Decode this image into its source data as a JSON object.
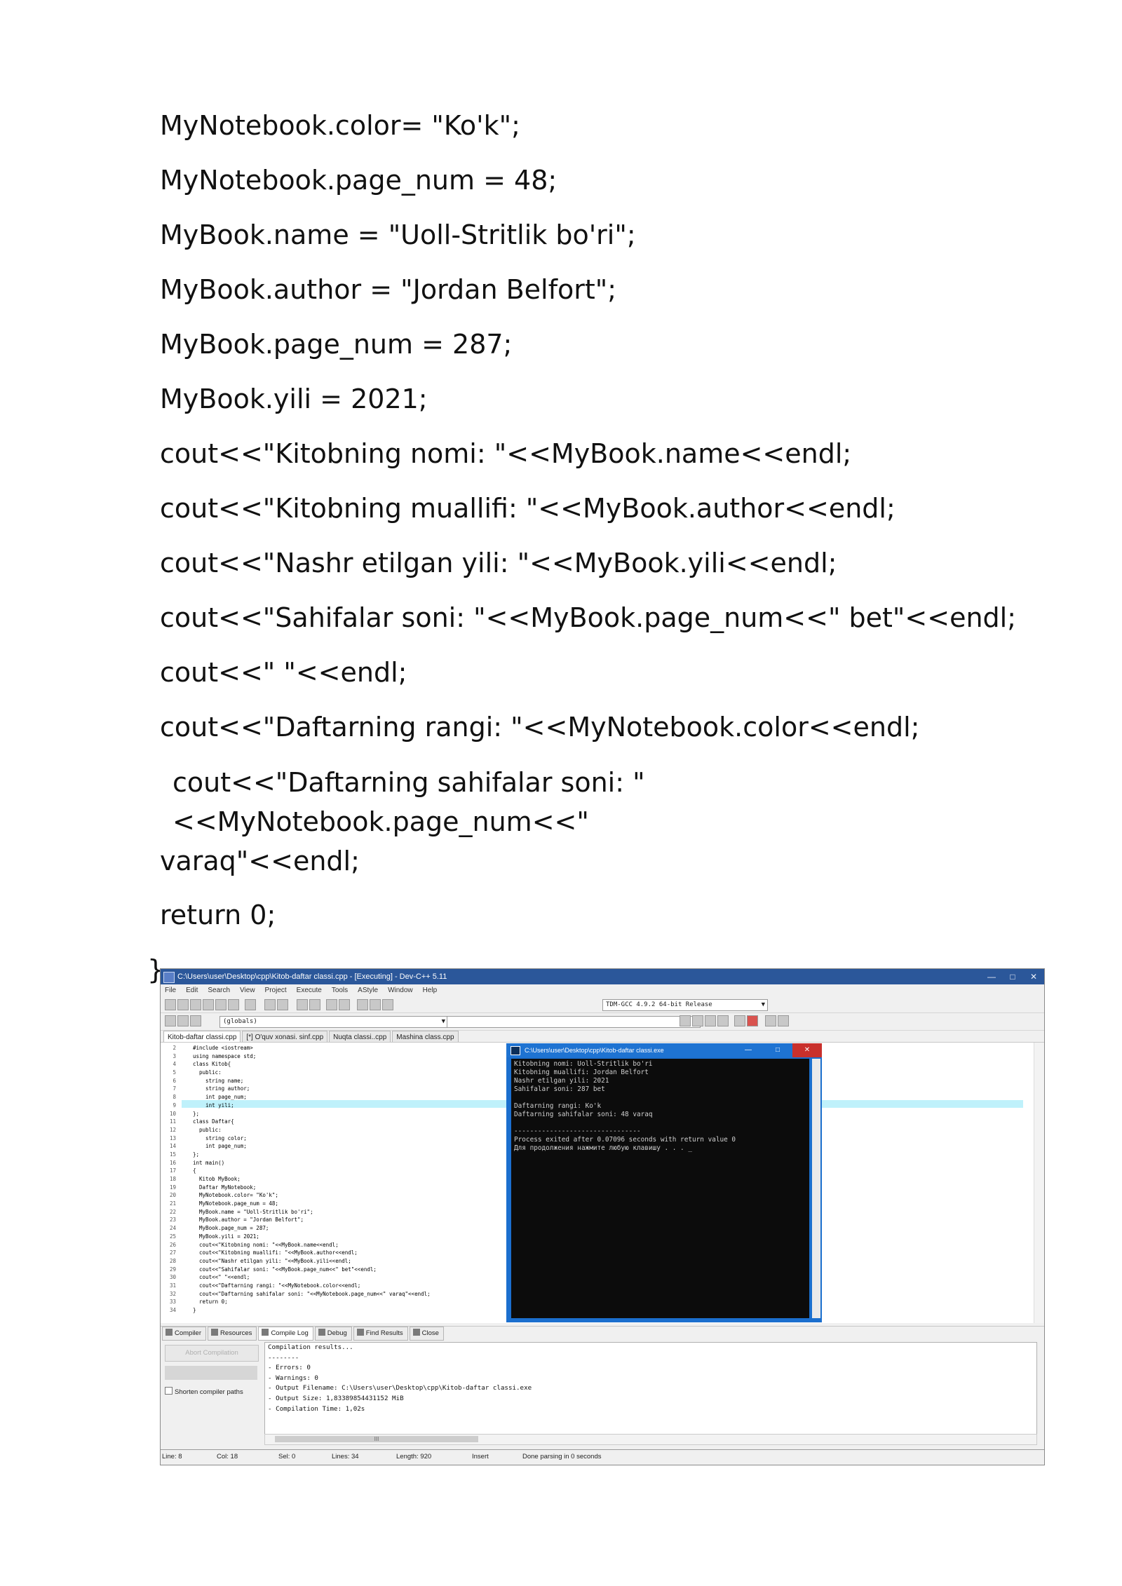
{
  "document": {
    "lines": [
      "MyNotebook.color= \"Ko'k\";",
      "MyNotebook.page_num = 48;",
      "MyBook.name = \"Uoll-Stritlik bo'ri\";",
      "MyBook.author = \"Jordan Belfort\";",
      "MyBook.page_num = 287;",
      "MyBook.yili = 2021;",
      "cout<<\"Kitobning nomi: \"<<MyBook.name<<endl;",
      "cout<<\"Kitobning muallifi: \"<<MyBook.author<<endl;",
      "cout<<\"Nashr etilgan yili: \"<<MyBook.yili<<endl;",
      "cout<<\"Sahifalar soni: \"<<MyBook.page_num<<\" bet\"<<endl;",
      "cout<<\" \"<<endl;",
      "cout<<\"Daftarning rangi: \"<<MyNotebook.color<<endl;"
    ],
    "wrapped_line_1": "cout<<\"Daftarning sahifalar soni: \"<<MyNotebook.page_num<<\"",
    "wrapped_line_2": "varaq\"<<endl;",
    "return_line": "return 0;",
    "closing_brace": "}"
  },
  "ide": {
    "title": "C:\\Users\\user\\Desktop\\cpp\\Kitob-daftar classi.cpp - [Executing] - Dev-C++ 5.11",
    "menu": [
      "File",
      "Edit",
      "Search",
      "View",
      "Project",
      "Execute",
      "Tools",
      "AStyle",
      "Window",
      "Help"
    ],
    "compiler_select": "TDM-GCC 4.9.2 64-bit Release",
    "globals_select": "(globals)",
    "tabs": [
      "Kitob-daftar classi.cpp",
      "[*] O'quv xonasi. sinf.cpp",
      "Nuqta classi..cpp",
      "Mashina class.cpp"
    ],
    "code": [
      {
        "n": "2",
        "t": "#include <iostream>"
      },
      {
        "n": "3",
        "t": "using namespace std;"
      },
      {
        "n": "4",
        "t": "class Kitob{"
      },
      {
        "n": "5",
        "t": "  public:"
      },
      {
        "n": "6",
        "t": "    string name;"
      },
      {
        "n": "7",
        "t": "    string author;"
      },
      {
        "n": "8",
        "t": "    int page_num;"
      },
      {
        "n": "9",
        "t": "    int yili;"
      },
      {
        "n": "10",
        "t": "};"
      },
      {
        "n": "11",
        "t": "class Daftar{"
      },
      {
        "n": "12",
        "t": "  public:"
      },
      {
        "n": "13",
        "t": "    string color;"
      },
      {
        "n": "14",
        "t": "    int page_num;"
      },
      {
        "n": "15",
        "t": "};"
      },
      {
        "n": "16",
        "t": "int main()"
      },
      {
        "n": "17",
        "t": "{"
      },
      {
        "n": "18",
        "t": "  Kitob MyBook;"
      },
      {
        "n": "19",
        "t": "  Daftar MyNotebook;"
      },
      {
        "n": "20",
        "t": "  MyNotebook.color= \"Ko'k\";"
      },
      {
        "n": "21",
        "t": "  MyNotebook.page_num = 48;"
      },
      {
        "n": "22",
        "t": "  MyBook.name = \"Uoll-Stritlik bo'ri\";"
      },
      {
        "n": "23",
        "t": "  MyBook.author = \"Jordan Belfort\";"
      },
      {
        "n": "24",
        "t": "  MyBook.page_num = 287;"
      },
      {
        "n": "25",
        "t": "  MyBook.yili = 2021;"
      },
      {
        "n": "26",
        "t": "  cout<<\"Kitobning nomi: \"<<MyBook.name<<endl;"
      },
      {
        "n": "27",
        "t": "  cout<<\"Kitobning muallifi: \"<<MyBook.author<<endl;"
      },
      {
        "n": "28",
        "t": "  cout<<\"Nashr etilgan yili: \"<<MyBook.yili<<endl;"
      },
      {
        "n": "29",
        "t": "  cout<<\"Sahifalar soni: \"<<MyBook.page_num<<\" bet\"<<endl;"
      },
      {
        "n": "30",
        "t": "  cout<<\" \"<<endl;"
      },
      {
        "n": "31",
        "t": "  cout<<\"Daftarning rangi: \"<<MyNotebook.color<<endl;"
      },
      {
        "n": "32",
        "t": "  cout<<\"Daftarning sahifalar soni: \"<<MyNotebook.page_num<<\" varaq\"<<endl;"
      },
      {
        "n": "33",
        "t": "  return 0;"
      },
      {
        "n": "34",
        "t": "}"
      }
    ],
    "console": {
      "title": "C:\\Users\\user\\Desktop\\cpp\\Kitob-daftar classi.exe",
      "lines": [
        "Kitobning nomi: Uoll-Stritlik bo'ri",
        "Kitobning muallifi: Jordan Belfort",
        "Nashr etilgan yili: 2021",
        "Sahifalar soni: 287 bet",
        "",
        "Daftarning rangi: Ko'k",
        "Daftarning sahifalar soni: 48 varaq",
        "",
        "--------------------------------",
        "Process exited after 0.07096 seconds with return value 0",
        "Для продолжения нажмите любую клавишу . . . _"
      ]
    },
    "bottom_tabs": [
      "Compiler",
      "Resources",
      "Compile Log",
      "Debug",
      "Find Results",
      "Close"
    ],
    "abort_label": "Abort Compilation",
    "shorten_label": "Shorten compiler paths",
    "log": [
      "Compilation results...",
      "--------",
      "- Errors: 0",
      "- Warnings: 0",
      "- Output Filename: C:\\Users\\user\\Desktop\\cpp\\Kitob-daftar classi.exe",
      "- Output Size: 1,83389854431152 MiB",
      "- Compilation Time: 1,02s"
    ],
    "status": {
      "line": "Line:   8",
      "col": "Col:   18",
      "sel": "Sel:   0",
      "lines": "Lines:   34",
      "length": "Length:   920",
      "mode": "Insert",
      "message": "Done parsing in 0 seconds"
    }
  }
}
